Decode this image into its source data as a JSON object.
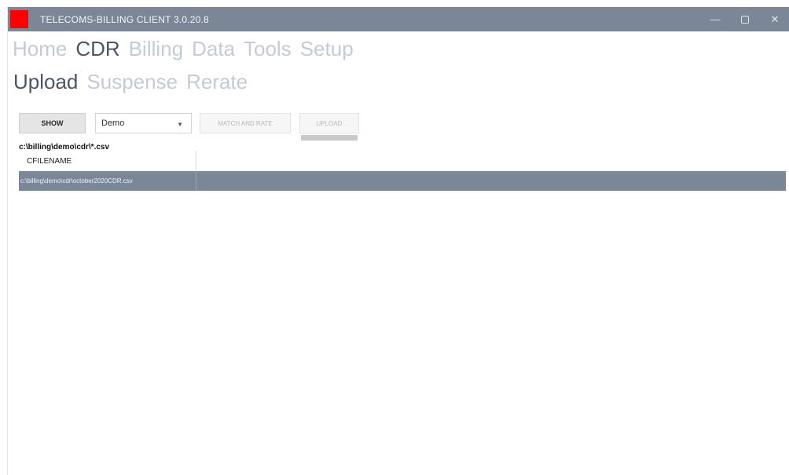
{
  "window": {
    "title": "TELECOMS-BILLING CLIENT 3.0.20.8",
    "controls": {
      "minimize": "—",
      "close": "✕"
    }
  },
  "menu": {
    "items": [
      {
        "label": "Home",
        "active": false
      },
      {
        "label": "CDR",
        "active": true
      },
      {
        "label": "Billing",
        "active": false
      },
      {
        "label": "Data",
        "active": false
      },
      {
        "label": "Tools",
        "active": false
      },
      {
        "label": "Setup",
        "active": false
      }
    ]
  },
  "subtabs": {
    "items": [
      {
        "label": "Upload",
        "active": true
      },
      {
        "label": "Suspense",
        "active": false
      },
      {
        "label": "Rerate",
        "active": false
      }
    ]
  },
  "toolbar": {
    "show_label": "SHOW",
    "select_value": "Demo",
    "match_label": "MATCH AND RATE",
    "upload_label": "UPLOAD"
  },
  "path": "c:\\billing\\demo\\cdr\\*.csv",
  "grid": {
    "columns": [
      "CFILENAME"
    ],
    "rows": [
      [
        "c:\\billing\\demo\\cdr\\october2020CDR.csv"
      ]
    ]
  },
  "colors": {
    "titlebar": "#7b8797",
    "app_icon": "#ff0000",
    "selected_row": "#7b8797"
  }
}
